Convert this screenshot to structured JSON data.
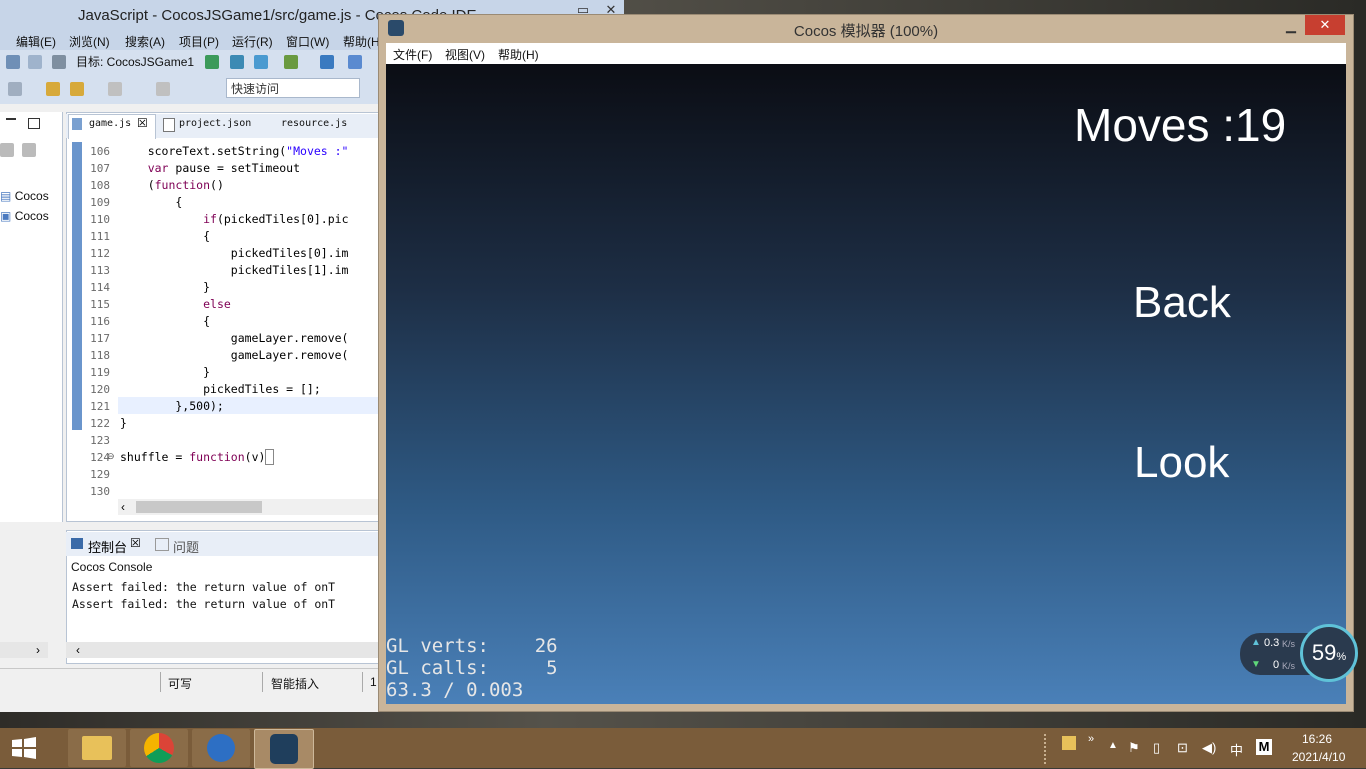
{
  "ide": {
    "title": "JavaScript - CocosJSGame1/src/game.js - Cocos Code IDE",
    "menu": [
      "编辑(E)",
      "浏览(N)",
      "搜索(A)",
      "项目(P)",
      "运行(R)",
      "窗口(W)",
      "帮助(H)"
    ],
    "target_label": "目标: CocosJSGame1",
    "quick_access_placeholder": "快速访问",
    "tree_items": [
      "Cocos",
      "Cocos"
    ],
    "tabs": [
      "game.js",
      "project.json",
      "resource.js"
    ],
    "line_numbers": [
      "106",
      "107",
      "108",
      "109",
      "110",
      "111",
      "112",
      "113",
      "114",
      "115",
      "116",
      "117",
      "118",
      "119",
      "120",
      "121",
      "122",
      "123",
      "124",
      "129",
      "130"
    ],
    "console_tabs": [
      "控制台",
      "问题"
    ],
    "console_title": "Cocos Console",
    "console_lines": [
      "Assert failed: the return value of onT",
      "Assert failed: the return value of onT"
    ],
    "status": [
      "可写",
      "智能插入",
      "1"
    ]
  },
  "simulator": {
    "title": "Cocos 模拟器 (100%)",
    "menu": [
      "文件(F)",
      "视图(V)",
      "帮助(H)"
    ],
    "moves_text": "Moves :19",
    "back_label": "Back",
    "look_label": "Look",
    "gl_verts": "GL verts:    26",
    "gl_calls": "GL calls:     5",
    "fps": "63.3 / 0.003"
  },
  "netwidget": {
    "upload": "0.3",
    "upload_unit": "K/s",
    "download": "0",
    "download_unit": "K/s",
    "cpu_percent": "59",
    "cpu_unit": "%"
  },
  "taskbar": {
    "time": "16:26",
    "date": "2021/4/10",
    "ime": "中",
    "ime2": "M"
  }
}
